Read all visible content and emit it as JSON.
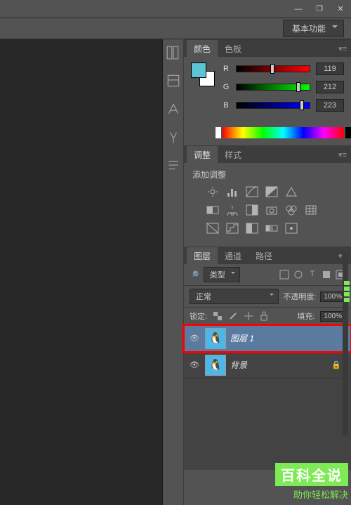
{
  "window": {
    "minimize": "—",
    "maximize": "❐",
    "close": "✕"
  },
  "menubar": {
    "workspace": "基本功能"
  },
  "panels": {
    "color": {
      "tab_color": "颜色",
      "tab_swatches": "色板",
      "r_label": "R",
      "g_label": "G",
      "b_label": "B",
      "r_val": "119",
      "g_val": "212",
      "b_val": "223"
    },
    "adjust": {
      "tab_adjust": "调整",
      "tab_styles": "样式",
      "heading": "添加调整"
    },
    "layers": {
      "tab_layers": "图层",
      "tab_channels": "通道",
      "tab_paths": "路径",
      "kind_label": "类型",
      "blend_mode": "正常",
      "opacity_label": "不透明度:",
      "opacity_val": "100%",
      "lock_label": "锁定:",
      "fill_label": "填充:",
      "fill_val": "100%",
      "layer1_name": "图层 1",
      "bg_name": "背景"
    }
  },
  "watermark": {
    "title": "百科全说",
    "sub": "助你轻松解决"
  }
}
